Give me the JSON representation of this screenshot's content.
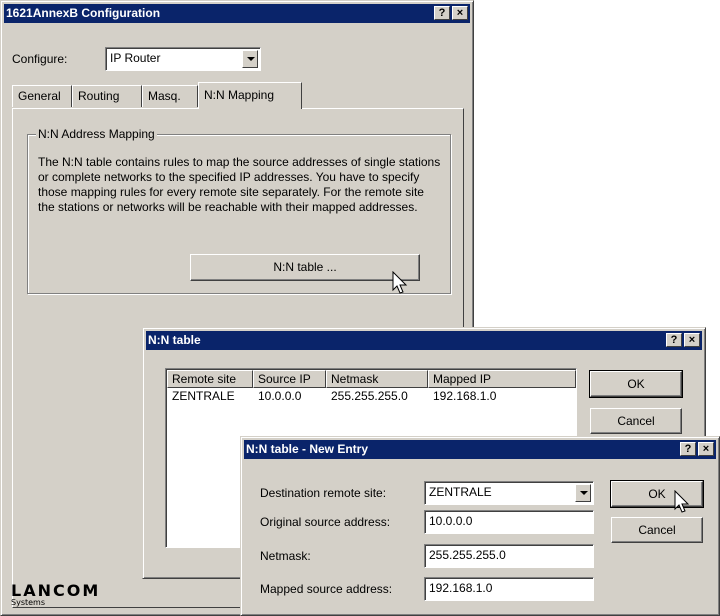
{
  "main_window": {
    "title": "1621AnnexB Configuration",
    "help_btn": "?",
    "close_btn": "×",
    "configure_label": "Configure:",
    "configure_value": "IP Router",
    "tabs": [
      {
        "label": "General"
      },
      {
        "label": "Routing"
      },
      {
        "label": "Masq."
      },
      {
        "label": "N:N Mapping"
      }
    ],
    "group_title": "N:N Address Mapping",
    "description": "The N:N table contains rules to map the source addresses of single stations or complete networks to the specified IP addresses. You have to specify those mapping rules for every remote site separately. For the remote site the stations or networks will be reachable with their mapped addresses.",
    "nn_table_button": "N:N table ..."
  },
  "nn_table_window": {
    "title": "N:N table",
    "help_btn": "?",
    "close_btn": "×",
    "columns": [
      "Remote site",
      "Source IP",
      "Netmask",
      "Mapped IP"
    ],
    "rows": [
      [
        "ZENTRALE",
        "10.0.0.0",
        "255.255.255.0",
        "192.168.1.0"
      ]
    ],
    "ok_label": "OK",
    "cancel_label": "Cancel"
  },
  "new_entry_window": {
    "title": "N:N table - New Entry",
    "help_btn": "?",
    "close_btn": "×",
    "dest_label": "Destination remote site:",
    "dest_value": "ZENTRALE",
    "orig_label": "Original source address:",
    "orig_value": "10.0.0.0",
    "netmask_label": "Netmask:",
    "netmask_value": "255.255.255.0",
    "mapped_label": "Mapped source address:",
    "mapped_value": "192.168.1.0",
    "ok_label": "OK",
    "cancel_label": "Cancel"
  },
  "brand": {
    "name": "LANCOM",
    "sub": "Systems"
  },
  "colors": {
    "titlebar": "#0a246a",
    "face": "#d4d0c8"
  }
}
